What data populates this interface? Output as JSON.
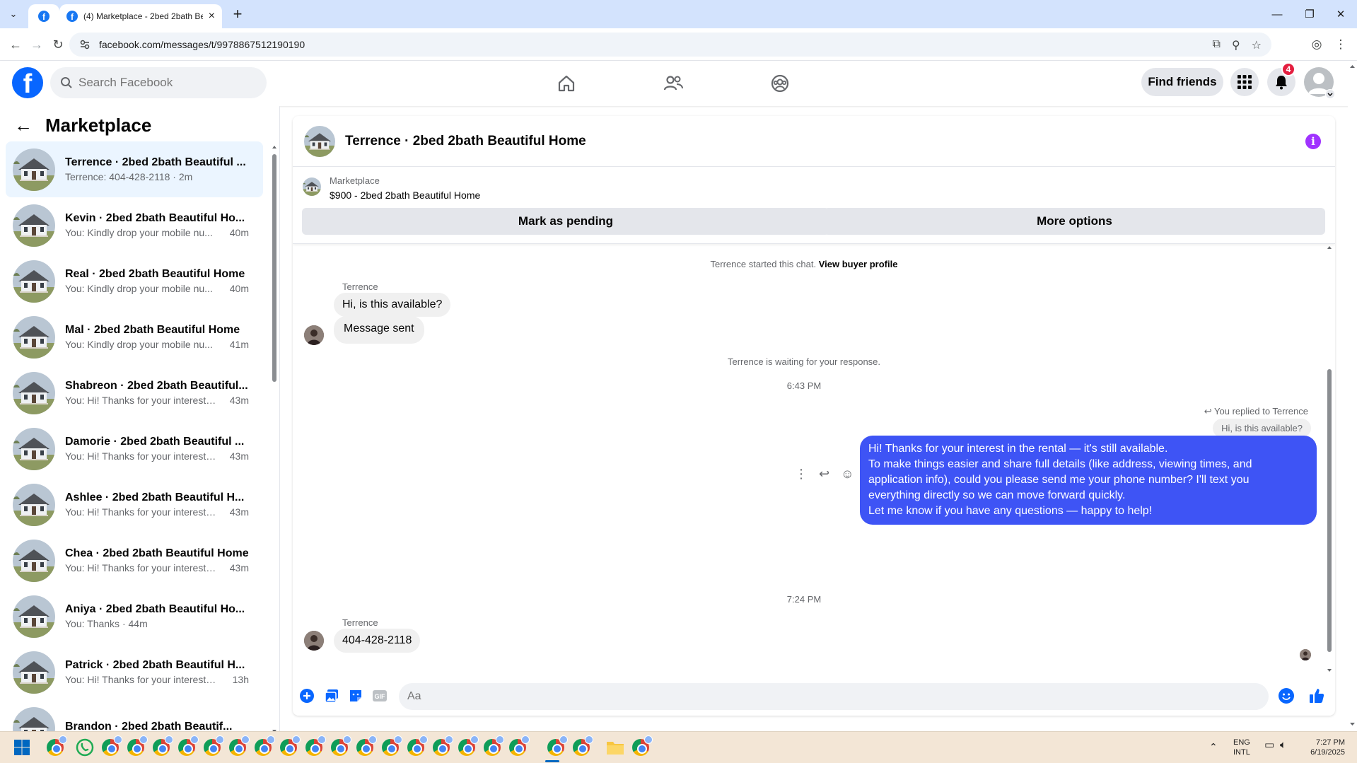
{
  "browser": {
    "tab_title": "(4) Marketplace - 2bed 2bath Beautiful Home",
    "url": "facebook.com/messages/t/9978867512190190"
  },
  "fb": {
    "logo_letter": "f",
    "search_placeholder": "Search Facebook",
    "find_friends": "Find friends",
    "notification_count": "4"
  },
  "sidebar": {
    "title": "Marketplace",
    "conversations": [
      {
        "name": "Terrence · 2bed 2bath Beautiful ...",
        "preview": "Terrence: 404-428-2118 · 2m",
        "time": ""
      },
      {
        "name": "Kevin · 2bed 2bath Beautiful Ho...",
        "preview": "You: Kindly drop your mobile nu...",
        "time": "40m"
      },
      {
        "name": "Real · 2bed 2bath Beautiful Home",
        "preview": "You: Kindly drop your mobile nu...",
        "time": "40m"
      },
      {
        "name": "Mal · 2bed 2bath Beautiful Home",
        "preview": "You: Kindly drop your mobile nu...",
        "time": "41m"
      },
      {
        "name": "Shabreon · 2bed 2bath Beautiful...",
        "preview": "You: Hi! Thanks for your interest i...",
        "time": "43m"
      },
      {
        "name": "Damorie · 2bed 2bath Beautiful ...",
        "preview": "You: Hi! Thanks for your interest i...",
        "time": "43m"
      },
      {
        "name": "Ashlee · 2bed 2bath Beautiful H...",
        "preview": "You: Hi! Thanks for your interest i...",
        "time": "43m"
      },
      {
        "name": "Chea · 2bed 2bath Beautiful Home",
        "preview": "You: Hi! Thanks for your interest i...",
        "time": "43m"
      },
      {
        "name": "Aniya · 2bed 2bath Beautiful Ho...",
        "preview": "You: Thanks · 44m",
        "time": ""
      },
      {
        "name": "Patrick · 2bed 2bath Beautiful H...",
        "preview": "You: Hi! Thanks for your interest in...",
        "time": "13h"
      },
      {
        "name": "Brandon · 2bed 2bath Beautif...",
        "preview": "",
        "time": ""
      }
    ]
  },
  "chat": {
    "title": "Terrence · 2bed 2bath Beautiful Home",
    "listing_source": "Marketplace",
    "listing_title": "$900 - 2bed 2bath Beautiful Home",
    "mark_pending": "Mark as pending",
    "more_options": "More options",
    "started_text": "Terrence started this chat.",
    "view_profile": "View buyer profile",
    "sender_name": "Terrence",
    "msg_1": "Hi, is this available?",
    "msg_2": "Message sent",
    "waiting_text": "Terrence is waiting for your response.",
    "time_1": "6:43 PM",
    "replied_to": "You replied to Terrence",
    "quoted": "Hi, is this available?",
    "out_lines": [
      "Hi! Thanks for your interest in the rental — it's still available.",
      "To make things easier and share full details (like address, viewing times, and",
      "application info), could you please send me your phone number? I'll text you",
      "everything directly so we can move forward quickly.",
      "Let me know if you have any questions — happy to help!"
    ],
    "time_2": "7:24 PM",
    "msg_3": "404-428-2118",
    "composer_placeholder": "Aa"
  },
  "taskbar": {
    "lang_1": "ENG",
    "lang_2": "INTL",
    "clock_time": "7:27 PM",
    "clock_date": "6/19/2025"
  },
  "colors": {
    "fb_blue": "#0866ff",
    "outgoing_bubble": "#3e54f5",
    "info_purple": "#a033ff",
    "badge_red": "#e41e3f"
  }
}
